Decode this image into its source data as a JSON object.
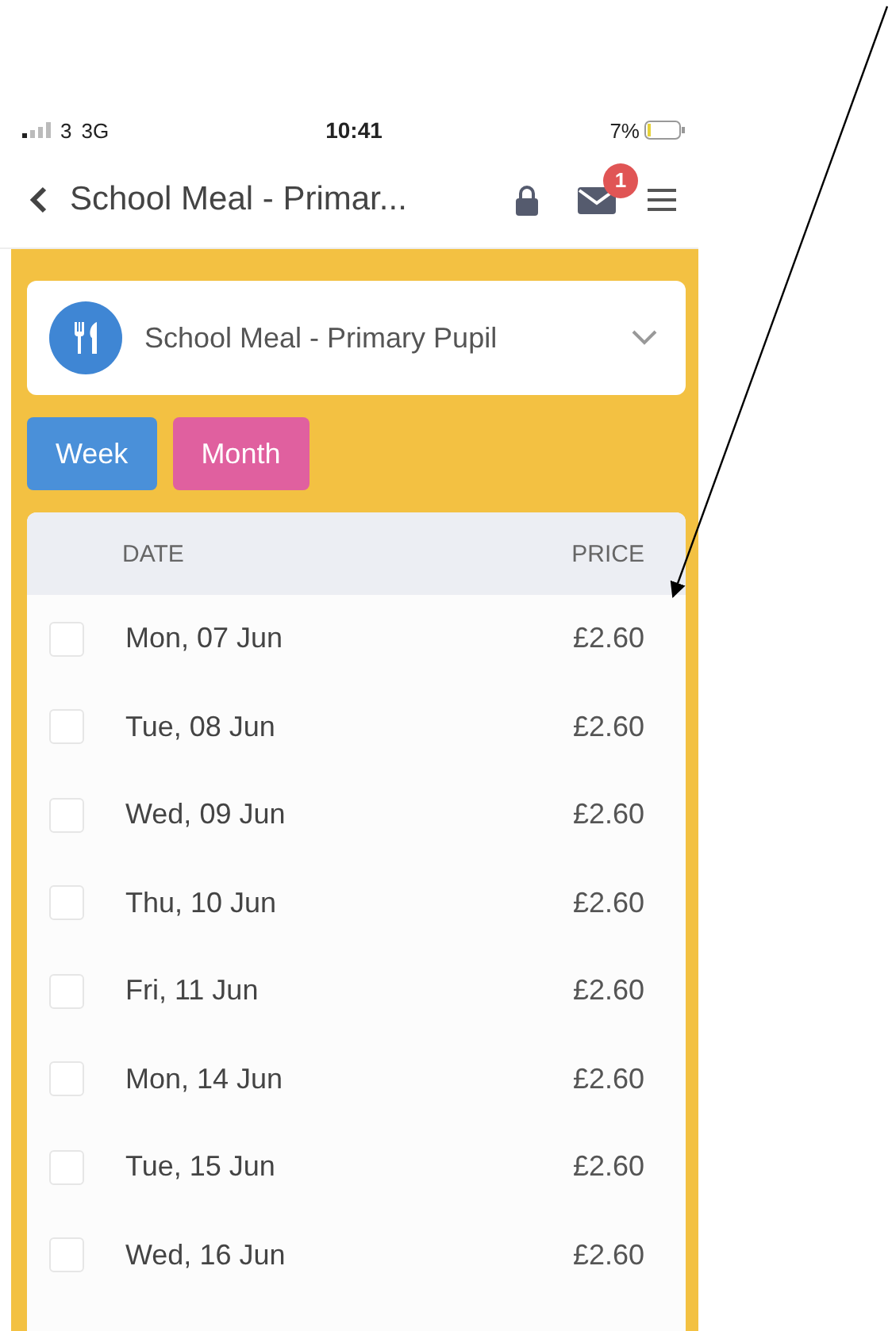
{
  "status_bar": {
    "carrier": "3",
    "network": "3G",
    "time": "10:41",
    "battery": "7%"
  },
  "nav": {
    "title": "School Meal - Primar...",
    "badge": "1"
  },
  "meal_select": {
    "value": "School Meal - Primary Pupil"
  },
  "view_buttons": [
    {
      "label": "Week",
      "kind": "week"
    },
    {
      "label": "Month",
      "kind": "month"
    }
  ],
  "table": {
    "columns": [
      "DATE",
      "PRICE"
    ],
    "rows": [
      {
        "date": "Mon, 07 Jun",
        "price": "£2.60",
        "checked": false
      },
      {
        "date": "Tue, 08 Jun",
        "price": "£2.60",
        "checked": false
      },
      {
        "date": "Wed, 09 Jun",
        "price": "£2.60",
        "checked": false
      },
      {
        "date": "Thu, 10 Jun",
        "price": "£2.60",
        "checked": false
      },
      {
        "date": "Fri, 11 Jun",
        "price": "£2.60",
        "checked": false
      },
      {
        "date": "Mon, 14 Jun",
        "price": "£2.60",
        "checked": false
      },
      {
        "date": "Tue, 15 Jun",
        "price": "£2.60",
        "checked": false
      },
      {
        "date": "Wed, 16 Jun",
        "price": "£2.60",
        "checked": false
      }
    ]
  }
}
